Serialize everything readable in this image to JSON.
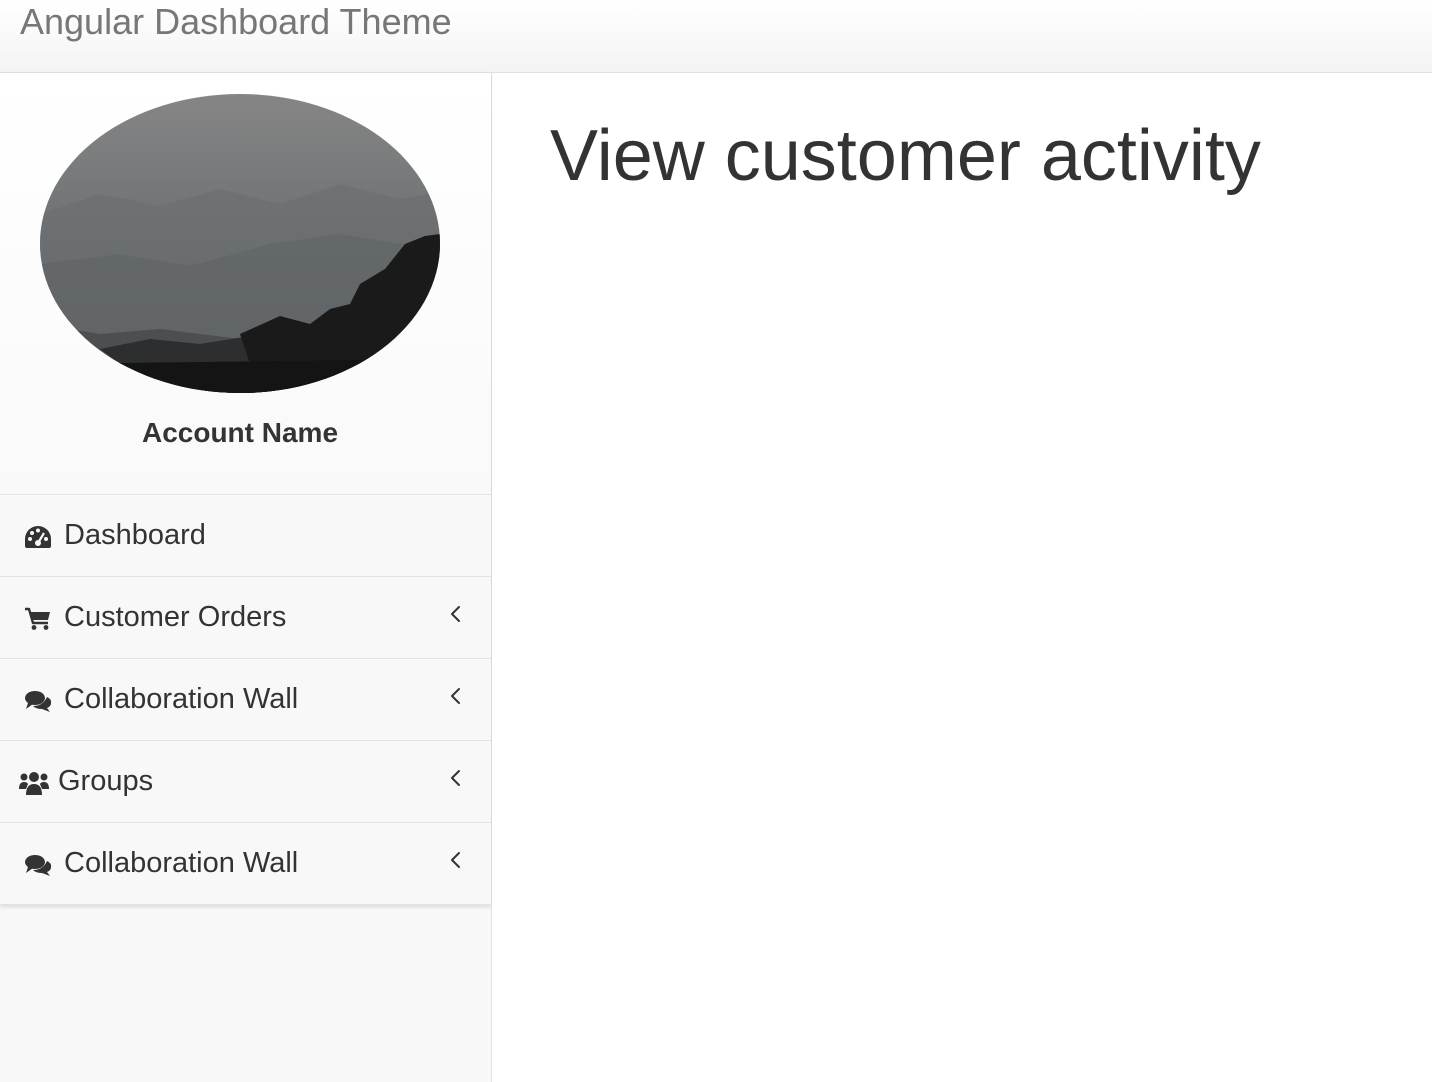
{
  "header": {
    "brand": "Angular Dashboard Theme"
  },
  "sidebar": {
    "account_name": "Account Name",
    "items": [
      {
        "label": "Dashboard",
        "icon": "dashboard-icon",
        "has_submenu": false
      },
      {
        "label": "Customer Orders",
        "icon": "shopping-cart-icon",
        "has_submenu": true
      },
      {
        "label": "Collaboration Wall",
        "icon": "comments-icon",
        "has_submenu": true
      },
      {
        "label": "Groups",
        "icon": "users-icon",
        "has_submenu": true
      },
      {
        "label": "Collaboration Wall",
        "icon": "comments-icon",
        "has_submenu": true
      }
    ]
  },
  "main": {
    "title": "View customer activity"
  },
  "colors": {
    "text": "#333333",
    "brand_text": "#777777",
    "sidebar_bg": "#f8f8f8",
    "border": "#e3e3e3"
  }
}
